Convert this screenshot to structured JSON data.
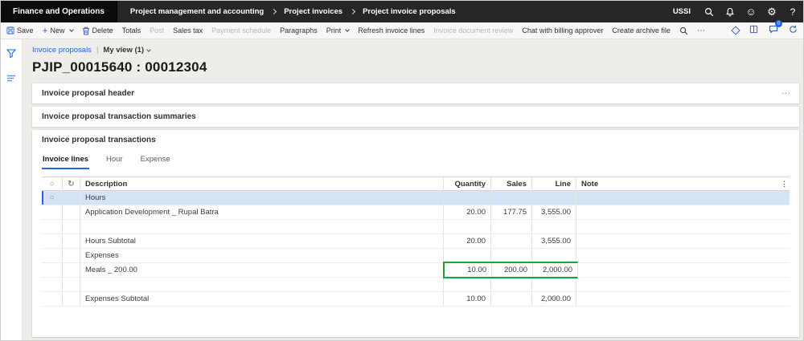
{
  "topbar": {
    "app_name": "Finance and Operations",
    "breadcrumb": [
      "Project management and accounting",
      "Project invoices",
      "Project invoice proposals"
    ],
    "company": "USSI",
    "icons": [
      "search-icon",
      "bell-icon",
      "smiley-icon",
      "gear-icon",
      "help-icon"
    ],
    "help_glyph": "?"
  },
  "toolbar": {
    "items": [
      {
        "label": "Save",
        "icon": "save-icon",
        "enabled": true
      },
      {
        "label": "New",
        "icon": "plus-icon",
        "dropdown": true,
        "enabled": true
      },
      {
        "label": "Delete",
        "icon": "trash-icon",
        "enabled": true
      },
      {
        "label": "Totals",
        "enabled": true
      },
      {
        "label": "Post",
        "enabled": false
      },
      {
        "label": "Sales tax",
        "enabled": true
      },
      {
        "label": "Payment schedule",
        "enabled": false
      },
      {
        "label": "Paragraphs",
        "enabled": true
      },
      {
        "label": "Print",
        "dropdown": true,
        "enabled": true
      },
      {
        "label": "Refresh invoice lines",
        "enabled": true
      },
      {
        "label": "Invoice document review",
        "enabled": false
      },
      {
        "label": "Chat with billing approver",
        "enabled": true
      },
      {
        "label": "Create archive file",
        "enabled": true
      }
    ],
    "right_icons": [
      "grid-diamond-icon",
      "book-icon",
      "chat-bubble-icon",
      "refresh-icon"
    ],
    "chat_badge_count": "0",
    "more_glyph": "⋯"
  },
  "page": {
    "back_link": "Invoice proposals",
    "separator": "|",
    "view_selector": "My view (1)",
    "title": "PJIP_00015640 : 00012304"
  },
  "sections": {
    "header": "Invoice proposal header",
    "summaries": "Invoice proposal transaction summaries",
    "transactions": "Invoice proposal transactions",
    "more_glyph": "···"
  },
  "tabs": [
    {
      "label": "Invoice lines",
      "active": true
    },
    {
      "label": "Hour",
      "active": false
    },
    {
      "label": "Expense",
      "active": false
    }
  ],
  "grid": {
    "select_all_glyph": "○",
    "refresh_glyph": "↻",
    "kebab_glyph": "⋮",
    "columns": {
      "description": "Description",
      "quantity": "Quantity",
      "sales_price": "Sales price",
      "line_amount": "Line amount",
      "note": "Note"
    },
    "rows": [
      {
        "description": "Hours",
        "quantity": "",
        "sales_price": "",
        "line_amount": "",
        "note": "",
        "selected": true,
        "radio_glyph": "○"
      },
      {
        "description": "Application Development _ Rupal Batra",
        "quantity": "20.00",
        "sales_price": "177.75",
        "line_amount": "3,555.00",
        "note": ""
      },
      {
        "description": "",
        "quantity": "",
        "sales_price": "",
        "line_amount": "",
        "note": ""
      },
      {
        "description": "Hours Subtotal",
        "quantity": "20.00",
        "sales_price": "",
        "line_amount": "3,555.00",
        "note": ""
      },
      {
        "description": "Expenses",
        "quantity": "",
        "sales_price": "",
        "line_amount": "",
        "note": ""
      },
      {
        "description": "Meals _ 200.00",
        "quantity": "10.00",
        "sales_price": "200.00",
        "line_amount": "2,000.00",
        "note": "",
        "highlighted": true
      },
      {
        "description": "",
        "quantity": "",
        "sales_price": "",
        "line_amount": "",
        "note": ""
      },
      {
        "description": "Expenses Subtotal",
        "quantity": "10.00",
        "sales_price": "",
        "line_amount": "2,000.00",
        "note": ""
      }
    ]
  },
  "colors": {
    "accent": "#2266E3",
    "selected_row": "#d5e3f7",
    "highlight_green": "#1ea33c",
    "topbar_bg": "#262626"
  }
}
